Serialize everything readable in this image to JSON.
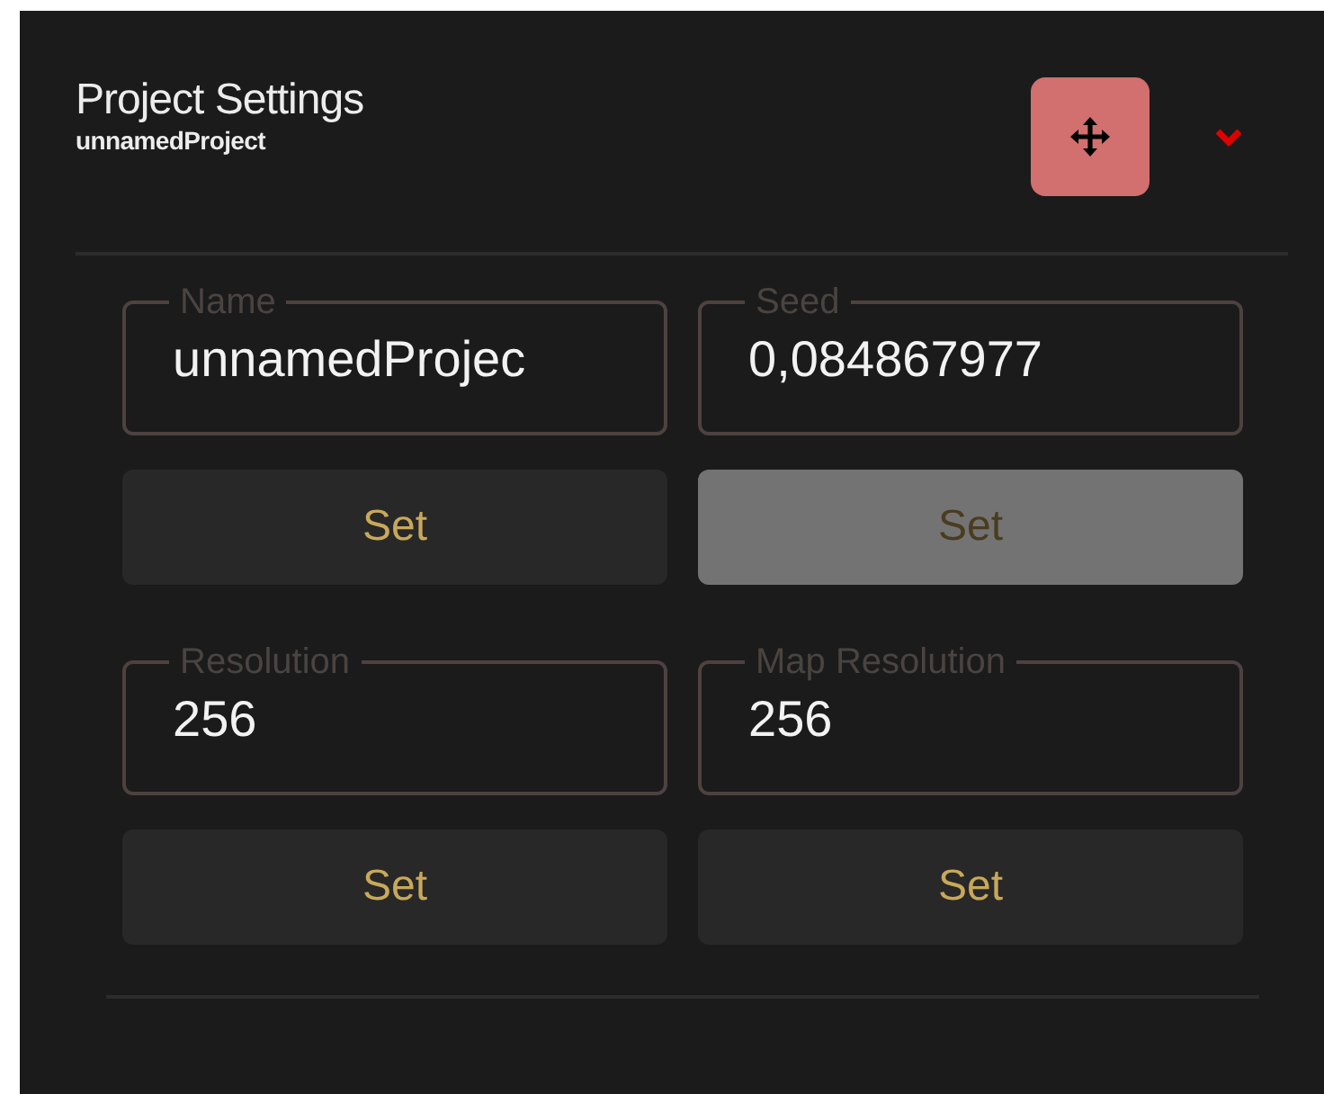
{
  "panel": {
    "title": "Project Settings",
    "subtitle": "unnamedProject"
  },
  "fields": [
    {
      "label": "Name",
      "value": "unnamedProjec",
      "button": {
        "label": "Set",
        "disabled": false
      }
    },
    {
      "label": "Seed",
      "value": "0,084867977",
      "button": {
        "label": "Set",
        "disabled": true
      }
    },
    {
      "label": "Resolution",
      "value": "256",
      "button": {
        "label": "Set",
        "disabled": false
      }
    },
    {
      "label": "Map Resolution",
      "value": "256",
      "button": {
        "label": "Set",
        "disabled": false
      }
    }
  ]
}
